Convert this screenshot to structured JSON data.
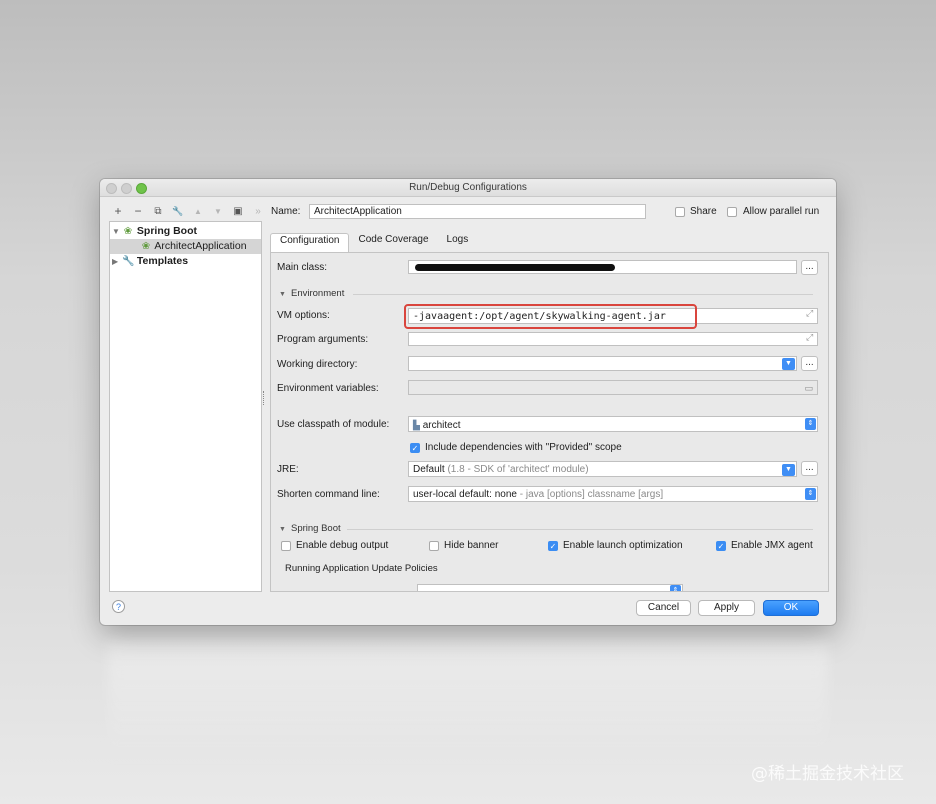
{
  "window": {
    "title": "Run/Debug Configurations"
  },
  "toolbar": {
    "icons": [
      "plus-icon",
      "minus-icon",
      "copy-icon",
      "wrench-icon",
      "up-icon",
      "down-icon",
      "folder-icon",
      "more-icon"
    ],
    "glyphs": {
      "add": "+",
      "remove": "−",
      "copy": "⧉",
      "edit": "🔧",
      "up": "▲",
      "down": "▼",
      "folder": "▣",
      "more": "»"
    }
  },
  "tree": {
    "items": [
      {
        "label": "Spring Boot",
        "level": 0,
        "expanded": true
      },
      {
        "label": "ArchitectApplication",
        "level": 1,
        "selected": true
      },
      {
        "label": "Templates",
        "level": 0,
        "expanded": false
      }
    ]
  },
  "header": {
    "name_label": "Name:",
    "name_value": "ArchitectApplication",
    "share_label": "Share",
    "parallel_label": "Allow parallel run"
  },
  "tabs": [
    {
      "label": "Configuration",
      "active": true
    },
    {
      "label": "Code Coverage"
    },
    {
      "label": "Logs"
    }
  ],
  "form": {
    "main_class_label": "Main class:",
    "environment_section": "Environment",
    "vm_options_label": "VM options:",
    "vm_options_value": "-javaagent:/opt/agent/skywalking-agent.jar",
    "program_args_label": "Program arguments:",
    "working_dir_label": "Working directory:",
    "env_vars_label": "Environment variables:",
    "classpath_label": "Use classpath of module:",
    "classpath_value": "architect",
    "include_deps_label": "Include dependencies with \"Provided\" scope",
    "include_deps_checked": true,
    "jre_label": "JRE:",
    "jre_value": "Default",
    "jre_hint": "(1.8 - SDK of 'architect' module)",
    "shorten_label": "Shorten command line:",
    "shorten_value": "user-local default: none",
    "shorten_hint": "- java [options] classname [args]",
    "ellipsis": "...",
    "spring_boot_section": "Spring Boot",
    "debug_output_label": "Enable debug output",
    "debug_output_checked": false,
    "hide_banner_label": "Hide banner",
    "hide_banner_checked": false,
    "launch_opt_label": "Enable launch optimization",
    "launch_opt_checked": true,
    "jmx_label": "Enable JMX agent",
    "jmx_checked": true,
    "update_policies_label": "Running Application Update Policies"
  },
  "footer": {
    "help": "?",
    "cancel": "Cancel",
    "apply": "Apply",
    "ok": "OK"
  },
  "watermark": "@稀土掘金技术社区",
  "colors": {
    "accent": "#3b8df3",
    "highlight": "#d9453d"
  }
}
